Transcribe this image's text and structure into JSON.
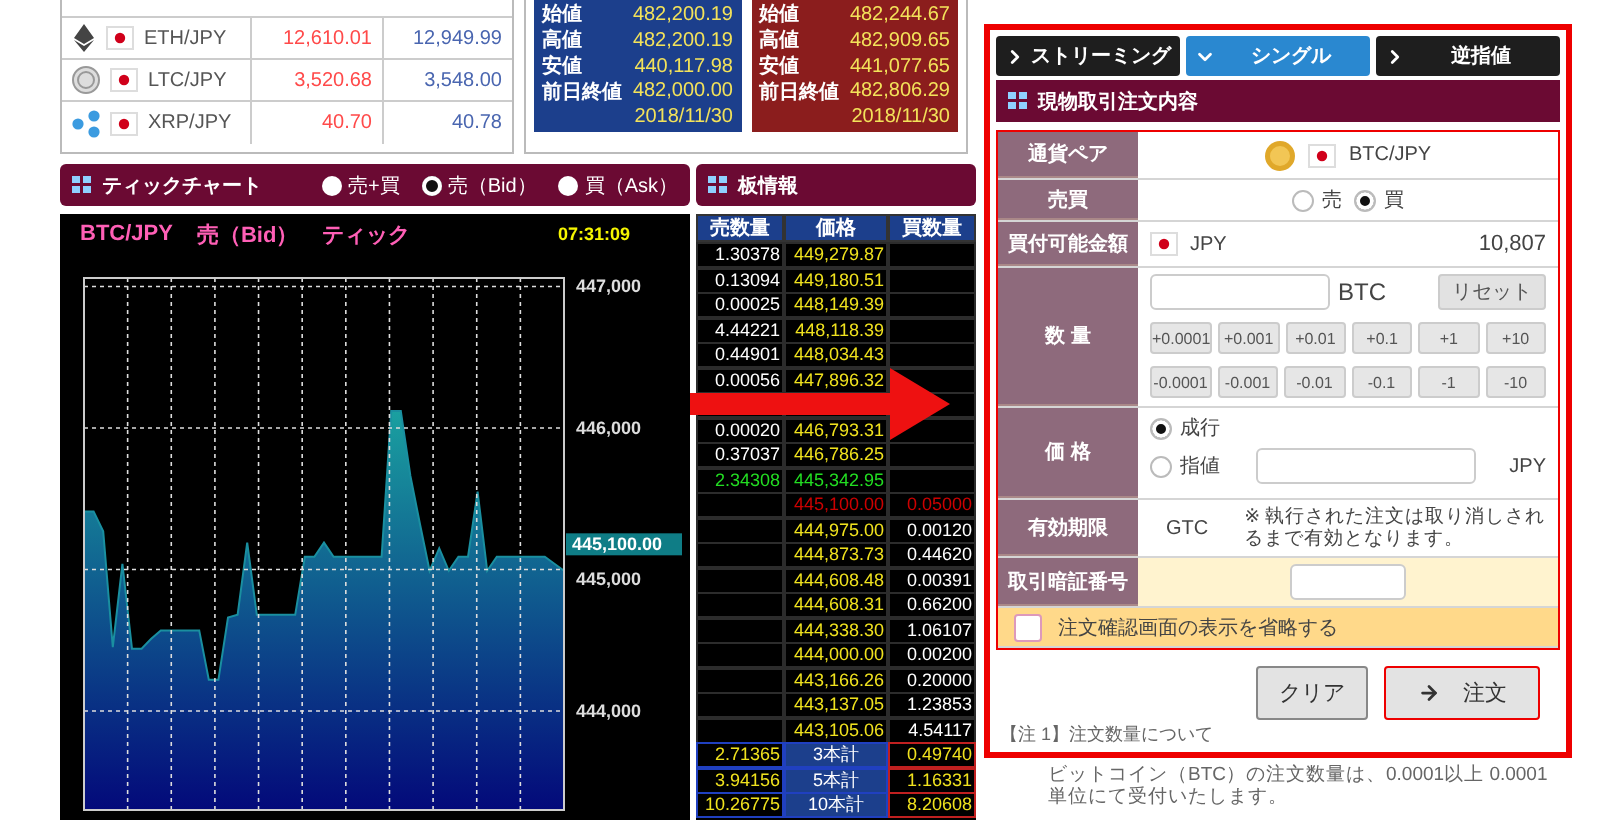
{
  "currency_table": {
    "rows": [
      {
        "kind": "eth",
        "pair": "ETH/JPY",
        "bid": "12,610.01",
        "ask": "12,949.99"
      },
      {
        "kind": "ltc",
        "pair": "LTC/JPY",
        "bid": "3,520.68",
        "ask": "3,548.00"
      },
      {
        "kind": "xrp",
        "pair": "XRP/JPY",
        "bid": "40.70",
        "ask": "40.78"
      }
    ]
  },
  "price_boxes": [
    {
      "kind": "bid",
      "rows": [
        {
          "label": "始値",
          "value": "482,200.19"
        },
        {
          "label": "高値",
          "value": "482,200.19"
        },
        {
          "label": "安値",
          "value": "440,117.98"
        },
        {
          "label": "前日終値",
          "value": "482,000.00"
        }
      ],
      "date": "2018/11/30"
    },
    {
      "kind": "ask",
      "rows": [
        {
          "label": "始値",
          "value": "482,244.67"
        },
        {
          "label": "高値",
          "value": "482,909.65"
        },
        {
          "label": "安値",
          "value": "441,077.65"
        },
        {
          "label": "前日終値",
          "value": "482,806.29"
        }
      ],
      "date": "2018/11/30"
    }
  ],
  "tick_chart": {
    "title": "ティックチャート",
    "modes": [
      {
        "label": "売+買",
        "selected": false
      },
      {
        "label": "売（Bid）",
        "selected": true
      },
      {
        "label": "買（Ask）",
        "selected": false
      }
    ],
    "pair": "BTC/JPY",
    "side": "売（Bid）",
    "type": "ティック",
    "time": "07:31:09",
    "current_price": "445,100.00",
    "chart_data": {
      "type": "area",
      "categories": [
        null,
        null,
        null,
        null,
        null,
        null,
        null,
        null,
        null,
        null,
        null,
        null,
        null,
        null,
        null,
        null,
        null,
        null,
        null,
        null,
        null,
        null,
        null,
        null,
        null,
        null,
        null,
        null,
        null,
        null,
        null,
        null,
        null,
        null,
        null,
        null,
        null,
        null,
        null,
        null,
        null,
        null,
        null,
        null,
        null,
        null,
        null,
        null,
        null,
        null,
        null
      ],
      "series": [
        {
          "color": "#1a8fa0",
          "values": [
            445410,
            445410,
            445270,
            444450,
            445040,
            444440,
            444440,
            444510,
            444570,
            444570,
            444570,
            444570,
            444570,
            444220,
            444220,
            444660,
            444680,
            445190,
            444680,
            444680,
            444680,
            444680,
            444680,
            445090,
            445090,
            445190,
            445090,
            445090,
            445090,
            445090,
            445090,
            445090,
            446120,
            446120,
            445660,
            445320,
            444990,
            445150,
            444990,
            445090,
            445090,
            445550,
            444990,
            445090,
            445090,
            445090,
            445090,
            445090,
            445090,
            445040,
            444990
          ]
        }
      ],
      "ylim": [
        443300,
        447060
      ],
      "grid": true,
      "yticks": [
        {
          "value": 444000,
          "label": "444,000"
        },
        {
          "value": 445000,
          "label": "445,000"
        },
        {
          "value": 446000,
          "label": "446,000"
        },
        {
          "value": 447000,
          "label": "447,000"
        }
      ]
    }
  },
  "order_book": {
    "title": "板情報",
    "columns": [
      "売数量",
      "価格",
      "買数量"
    ],
    "rows": [
      {
        "kind": "ask",
        "sell": "1.30378",
        "price": "449,279.87"
      },
      {
        "kind": "ask",
        "sell": "0.13094",
        "price": "449,180.51"
      },
      {
        "kind": "ask",
        "sell": "0.00025",
        "price": "448,149.39"
      },
      {
        "kind": "ask",
        "sell": "4.44221",
        "price": "448,118.39"
      },
      {
        "kind": "ask",
        "sell": "0.44901",
        "price": "448,034.43"
      },
      {
        "kind": "ask",
        "sell": "0.00056",
        "price": "447,896.32"
      },
      {
        "kind": "ask"
      },
      {
        "kind": "ask",
        "sell": "0.00020",
        "price": "446,793.31"
      },
      {
        "kind": "ask",
        "sell": "0.37037",
        "price": "446,786.25"
      },
      {
        "kind": "best_ask",
        "sell": "2.34308",
        "price": "445,342.95"
      },
      {
        "kind": "best_bid",
        "price": "445,100.00",
        "buy": "0.05000"
      },
      {
        "kind": "bid",
        "price": "444,975.00",
        "buy": "0.00120"
      },
      {
        "kind": "bid",
        "price": "444,873.73",
        "buy": "0.44620"
      },
      {
        "kind": "bid",
        "price": "444,608.48",
        "buy": "0.00391"
      },
      {
        "kind": "bid",
        "price": "444,608.31",
        "buy": "0.66200"
      },
      {
        "kind": "bid",
        "price": "444,338.30",
        "buy": "1.06107"
      },
      {
        "kind": "bid",
        "price": "444,000.00",
        "buy": "0.00200"
      },
      {
        "kind": "bid",
        "price": "443,166.26",
        "buy": "0.20000"
      },
      {
        "kind": "bid",
        "price": "443,137.05",
        "buy": "1.23853"
      },
      {
        "kind": "bid",
        "price": "443,105.06",
        "buy": "4.54117"
      }
    ],
    "totals": [
      {
        "sell": "2.71365",
        "label": "3本計",
        "buy": "0.49740"
      },
      {
        "sell": "3.94156",
        "label": "5本計",
        "buy": "1.16331"
      },
      {
        "sell": "10.26775",
        "label": "10本計",
        "buy": "8.20608"
      }
    ]
  },
  "order_panel": {
    "tabs": [
      {
        "label": "ストリーミング",
        "selected": false
      },
      {
        "label": "シングル",
        "selected": true
      },
      {
        "label": "逆指値",
        "selected": false
      }
    ],
    "title": "現物取引注文内容",
    "pair": {
      "label": "通貨ペア",
      "value": "BTC/JPY"
    },
    "side": {
      "label": "売買",
      "options": [
        {
          "label": "売",
          "selected": false
        },
        {
          "label": "買",
          "selected": true
        }
      ]
    },
    "buying_power": {
      "label": "買付可能金額",
      "currency": "JPY",
      "amount": "10,807"
    },
    "quantity": {
      "label": "数 量",
      "unit": "BTC",
      "reset": "リセット",
      "increments": [
        "+0.0001",
        "+0.001",
        "+0.01",
        "+0.1",
        "+1",
        "+10"
      ],
      "decrements": [
        "-0.0001",
        "-0.001",
        "-0.01",
        "-0.1",
        "-1",
        "-10"
      ]
    },
    "price": {
      "label": "価 格",
      "options": [
        {
          "label": "成行",
          "selected": true
        },
        {
          "label": "指値",
          "selected": false
        }
      ],
      "unit": "JPY"
    },
    "expiry": {
      "label": "有効期限",
      "value": "GTC",
      "note": "※ 執行された注文は取り消しされるまで有効となります。"
    },
    "pin": {
      "label": "取引暗証番号"
    },
    "skip_confirm": {
      "label": "注文確認画面の表示を省略する",
      "checked": false
    },
    "buttons": [
      {
        "kind": "clear",
        "label": "クリア"
      },
      {
        "kind": "submit",
        "label": "注文"
      }
    ],
    "note_title": "【注 1】注文数量について",
    "note": "ビットコイン（BTC）の注文数量は、0.0001以上 0.0001単位にて受付いたします。"
  }
}
